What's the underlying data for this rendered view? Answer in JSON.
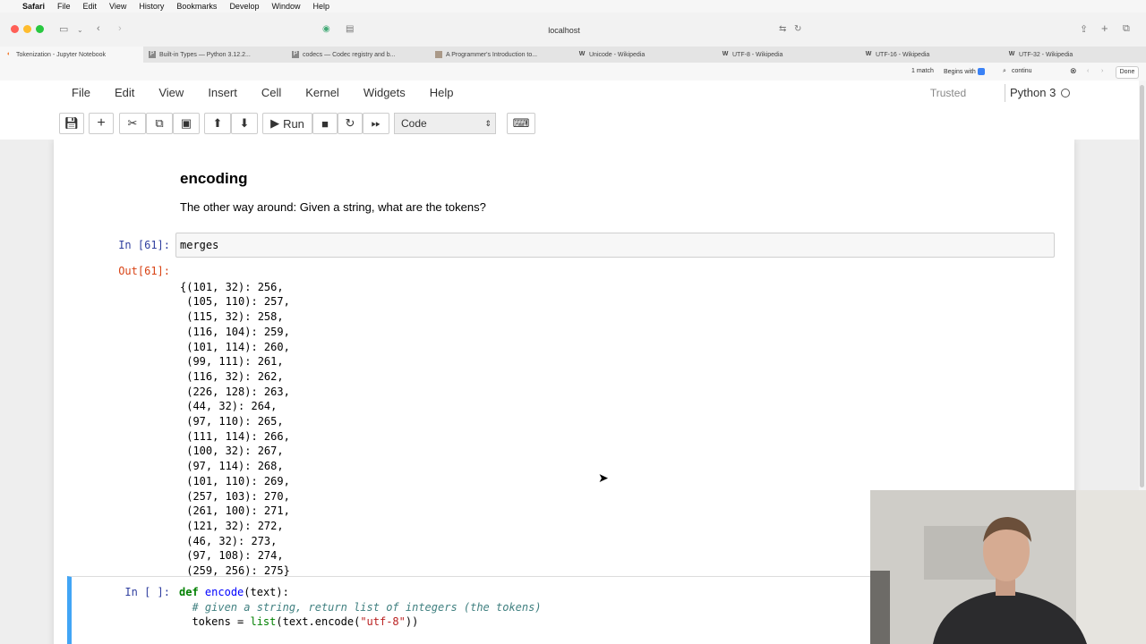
{
  "mac_menu": [
    "Safari",
    "File",
    "Edit",
    "View",
    "History",
    "Bookmarks",
    "Develop",
    "Window",
    "Help"
  ],
  "browser": {
    "url": "localhost"
  },
  "tabs": [
    {
      "label": "Tokenization - Jupyter Notebook",
      "icon": "jupyter-icon"
    },
    {
      "label": "Built-in Types — Python 3.12.2...",
      "icon": "python-docs-icon"
    },
    {
      "label": "codecs — Codec registry and b...",
      "icon": "python-docs-icon"
    },
    {
      "label": "A Programmer's Introduction to...",
      "icon": "image-icon"
    },
    {
      "label": "Unicode - Wikipedia",
      "icon": "wikipedia-icon"
    },
    {
      "label": "UTF-8 - Wikipedia",
      "icon": "wikipedia-icon"
    },
    {
      "label": "UTF-16 - Wikipedia",
      "icon": "wikipedia-icon"
    },
    {
      "label": "UTF-32 - Wikipedia",
      "icon": "wikipedia-icon"
    }
  ],
  "find": {
    "matches": "1 match",
    "mode": "Begins with",
    "query": "continu",
    "done": "Done"
  },
  "jupyter": {
    "menu": [
      "File",
      "Edit",
      "View",
      "Insert",
      "Cell",
      "Kernel",
      "Widgets",
      "Help"
    ],
    "trusted": "Trusted",
    "kernel": "Python 3",
    "run_label": "Run",
    "cell_type": "Code"
  },
  "markdown": {
    "heading": "encoding",
    "text": "The other way around: Given a string, what are the tokens?"
  },
  "cell61": {
    "in_prompt": "In [61]:",
    "source": "merges",
    "out_prompt": "Out[61]:",
    "output_lines": [
      "{(101, 32): 256,",
      " (105, 110): 257,",
      " (115, 32): 258,",
      " (116, 104): 259,",
      " (101, 114): 260,",
      " (99, 111): 261,",
      " (116, 32): 262,",
      " (226, 128): 263,",
      " (44, 32): 264,",
      " (97, 110): 265,",
      " (111, 114): 266,",
      " (100, 32): 267,",
      " (97, 114): 268,",
      " (101, 110): 269,",
      " (257, 103): 270,",
      " (261, 100): 271,",
      " (121, 32): 272,",
      " (46, 32): 273,",
      " (97, 108): 274,",
      " (259, 256): 275}"
    ]
  },
  "cell_next": {
    "in_prompt": "In [ ]:",
    "line1_kw": "def",
    "line1_fn": "encode",
    "line1_rest": "(text):",
    "line2_comment": "# given a string, return list of integers (the tokens)",
    "line3_a": "tokens = ",
    "line3_builtin": "list",
    "line3_b": "(text.encode(",
    "line3_str": "\"utf-8\"",
    "line3_c": "))"
  },
  "colors": {
    "selected_cell_border": "#42a5f5",
    "in_prompt": "#303f9f",
    "out_prompt": "#d84315"
  }
}
